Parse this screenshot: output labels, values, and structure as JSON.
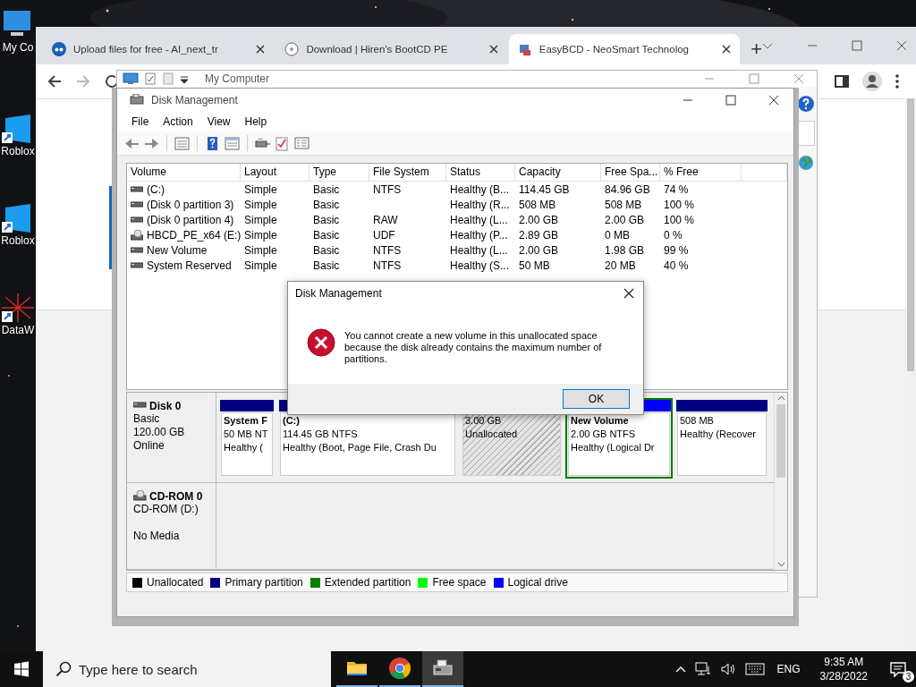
{
  "desktop_icons": [
    {
      "label": "My Co",
      "kind": "computer"
    },
    {
      "label": "Roblox",
      "kind": "tile"
    },
    {
      "label": "Roblox",
      "kind": "tile"
    },
    {
      "label": "DataW",
      "kind": "web"
    }
  ],
  "browser": {
    "tabs": [
      {
        "title": "Upload files for free - AI_next_tr",
        "kind": "cloud",
        "selected": false
      },
      {
        "title": "Download | Hiren's BootCD PE",
        "kind": "disc",
        "selected": false
      },
      {
        "title": "EasyBCD - NeoSmart Technolog",
        "kind": "app",
        "selected": true
      }
    ],
    "new_tab": "+"
  },
  "my_computer": {
    "title": "My Computer"
  },
  "disk_management": {
    "title": "Disk Management",
    "menu": [
      "File",
      "Action",
      "View",
      "Help"
    ],
    "columns": [
      "Volume",
      "Layout",
      "Type",
      "File System",
      "Status",
      "Capacity",
      "Free Spa...",
      "% Free"
    ],
    "rows": [
      {
        "kind": "disk",
        "cells": [
          "(C:)",
          "Simple",
          "Basic",
          "NTFS",
          "Healthy (B...",
          "114.45 GB",
          "84.96 GB",
          "74 %"
        ]
      },
      {
        "kind": "disk",
        "cells": [
          "(Disk 0 partition 3)",
          "Simple",
          "Basic",
          "",
          "Healthy (R...",
          "508 MB",
          "508 MB",
          "100 %"
        ]
      },
      {
        "kind": "disk",
        "cells": [
          "(Disk 0 partition 4)",
          "Simple",
          "Basic",
          "RAW",
          "Healthy (L...",
          "2.00 GB",
          "2.00 GB",
          "100 %"
        ]
      },
      {
        "kind": "cd",
        "cells": [
          "HBCD_PE_x64 (E:)",
          "Simple",
          "Basic",
          "UDF",
          "Healthy (P...",
          "2.89 GB",
          "0 MB",
          "0 %"
        ]
      },
      {
        "kind": "disk",
        "cells": [
          "New Volume",
          "Simple",
          "Basic",
          "NTFS",
          "Healthy (L...",
          "2.00 GB",
          "1.98 GB",
          "99 %"
        ]
      },
      {
        "kind": "disk",
        "cells": [
          "System Reserved",
          "Simple",
          "Basic",
          "NTFS",
          "Healthy (S...",
          "50 MB",
          "20 MB",
          "40 %"
        ]
      }
    ],
    "disks": [
      {
        "kind": "disk",
        "name": "Disk 0",
        "type": "Basic",
        "size": "120.00 GB",
        "status": "Online",
        "partitions": [
          {
            "kind": "primary",
            "name": "System F",
            "size": "50 MB NT",
            "status": "Healthy (",
            "extended": false
          },
          {
            "kind": "primary",
            "name": "(C:)",
            "size": "114.45 GB NTFS",
            "status": "Healthy (Boot, Page File, Crash Du",
            "extended": false
          },
          {
            "kind": "unallocated",
            "size": "3.00 GB",
            "status": "Unallocated",
            "extended": false
          },
          {
            "kind": "logical",
            "name": "New Volume",
            "size": "2.00 GB NTFS",
            "status": "Healthy (Logical Dr",
            "extended": true
          },
          {
            "kind": "primary",
            "size": "508 MB",
            "status": "Healthy (Recover",
            "extended": false
          }
        ]
      },
      {
        "kind": "cd",
        "name": "CD-ROM 0",
        "type": "CD-ROM (D:)",
        "status": "No Media"
      }
    ],
    "legend": [
      {
        "kind": "unallocated",
        "label": "Unallocated",
        "color": "#000000"
      },
      {
        "kind": "primary",
        "label": "Primary partition",
        "color": "#000080"
      },
      {
        "kind": "extended",
        "label": "Extended partition",
        "color": "#008000"
      },
      {
        "kind": "free",
        "label": "Free space",
        "color": "#00ff00"
      },
      {
        "kind": "logical",
        "label": "Logical drive",
        "color": "#0000ff"
      }
    ]
  },
  "dialog": {
    "title": "Disk Management",
    "message": "You cannot create a new volume in this unallocated space because the disk already contains the maximum number of partitions.",
    "buttons": [
      "OK"
    ]
  },
  "taskbar": {
    "search_placeholder": "Type here to search",
    "apps": [
      {
        "kind": "folder",
        "selected": false
      },
      {
        "kind": "browser",
        "selected": false
      },
      {
        "kind": "disk",
        "selected": true
      }
    ],
    "language": "ENG",
    "time": "9:35 AM",
    "date": "3/28/2022",
    "notifications": "3"
  }
}
